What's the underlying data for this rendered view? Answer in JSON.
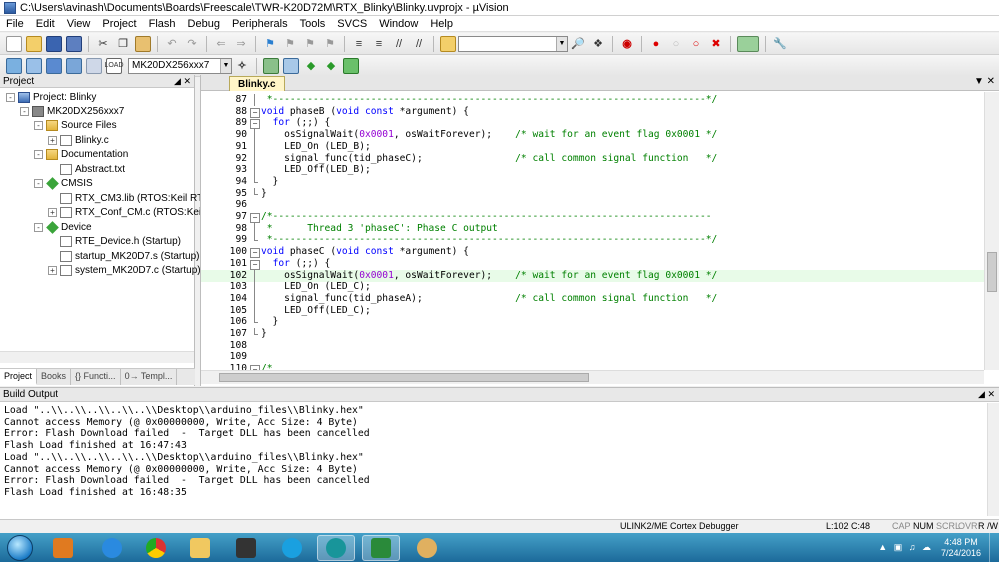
{
  "window": {
    "title": "C:\\Users\\avinash\\Documents\\Boards\\Freescale\\TWR-K20D72M\\RTX_Blinky\\Blinky.uvprojx - µVision"
  },
  "menu": [
    "File",
    "Edit",
    "View",
    "Project",
    "Flash",
    "Debug",
    "Peripherals",
    "Tools",
    "SVCS",
    "Window",
    "Help"
  ],
  "toolbar": {
    "find_value": "",
    "target_select": "MK20DX256xxx7"
  },
  "project_panel": {
    "title": "Project",
    "tree": [
      {
        "label": "Project: Blinky",
        "icon": "project-icon",
        "expander": "-"
      },
      {
        "label": "MK20DX256xxx7",
        "icon": "target-icon",
        "expander": "-"
      },
      {
        "label": "Source Files",
        "icon": "folder-icon",
        "expander": "-"
      },
      {
        "label": "Blinky.c",
        "icon": "file-icon",
        "expander": "+"
      },
      {
        "label": "Documentation",
        "icon": "folder-icon",
        "expander": "-"
      },
      {
        "label": "Abstract.txt",
        "icon": "file-icon",
        "expander": ""
      },
      {
        "label": "CMSIS",
        "icon": "component-icon",
        "expander": "-"
      },
      {
        "label": "RTX_CM3.lib (RTOS:Keil RTX)",
        "icon": "file-icon",
        "expander": ""
      },
      {
        "label": "RTX_Conf_CM.c (RTOS:Keil RT",
        "icon": "file-icon",
        "expander": "+"
      },
      {
        "label": "Device",
        "icon": "component-icon",
        "expander": "-"
      },
      {
        "label": "RTE_Device.h (Startup)",
        "icon": "file-icon",
        "expander": ""
      },
      {
        "label": "startup_MK20D7.s (Startup)",
        "icon": "file-icon",
        "expander": ""
      },
      {
        "label": "system_MK20D7.c (Startup)",
        "icon": "file-icon",
        "expander": "+"
      }
    ],
    "tabs": [
      "Project",
      "Books",
      "{} Functi...",
      "0→ Templ..."
    ]
  },
  "editor": {
    "tab": "Blinky.c",
    "lines": [
      {
        "n": "87",
        "fold": "bar",
        "t": " *---------------------------------------------------------------------------*/",
        "hl": false
      },
      {
        "n": "88",
        "fold": "box",
        "t": "void phaseB (void const *argument) {",
        "hl": false
      },
      {
        "n": "89",
        "fold": "box",
        "t": "  for (;;) {",
        "hl": false
      },
      {
        "n": "90",
        "fold": "bar",
        "t": "    osSignalWait(0x0001, osWaitForever);    /* wait for an event flag 0x0001 */",
        "hl": false
      },
      {
        "n": "91",
        "fold": "bar",
        "t": "    LED_On (LED_B);",
        "hl": false
      },
      {
        "n": "92",
        "fold": "bar",
        "t": "    signal_func(tid_phaseC);                /* call common signal function   */",
        "hl": false
      },
      {
        "n": "93",
        "fold": "bar",
        "t": "    LED_Off(LED_B);",
        "hl": false
      },
      {
        "n": "94",
        "fold": "end",
        "t": "  }",
        "hl": false
      },
      {
        "n": "95",
        "fold": "end",
        "t": "}",
        "hl": false
      },
      {
        "n": "96",
        "fold": "",
        "t": "",
        "hl": false
      },
      {
        "n": "97",
        "fold": "box",
        "t": "/*----------------------------------------------------------------------------",
        "hl": false
      },
      {
        "n": "98",
        "fold": "bar",
        "t": " *      Thread 3 'phaseC': Phase C output",
        "hl": false
      },
      {
        "n": "99",
        "fold": "end",
        "t": " *---------------------------------------------------------------------------*/",
        "hl": false
      },
      {
        "n": "100",
        "fold": "box",
        "t": "void phaseC (void const *argument) {",
        "hl": false
      },
      {
        "n": "101",
        "fold": "box",
        "t": "  for (;;) {",
        "hl": false
      },
      {
        "n": "102",
        "fold": "bar",
        "t": "    osSignalWait(0x0001, osWaitForever);    /* wait for an event flag 0x0001 */",
        "hl": true
      },
      {
        "n": "103",
        "fold": "bar",
        "t": "    LED_On (LED_C);",
        "hl": false
      },
      {
        "n": "104",
        "fold": "bar",
        "t": "    signal_func(tid_phaseA);                /* call common signal function   */",
        "hl": false
      },
      {
        "n": "105",
        "fold": "bar",
        "t": "    LED_Off(LED_C);",
        "hl": false
      },
      {
        "n": "106",
        "fold": "end",
        "t": "  }",
        "hl": false
      },
      {
        "n": "107",
        "fold": "end",
        "t": "}",
        "hl": false
      },
      {
        "n": "108",
        "fold": "",
        "t": "",
        "hl": false
      },
      {
        "n": "109",
        "fold": "",
        "t": "",
        "hl": false
      },
      {
        "n": "110",
        "fold": "box",
        "t": "/*",
        "hl": false
      }
    ]
  },
  "build_output": {
    "title": "Build Output",
    "lines": [
      "Load \"..\\\\..\\\\..\\\\..\\\\..\\\\Desktop\\\\arduino_files\\\\Blinky.hex\"",
      "Cannot access Memory (@ 0x00000000, Write, Acc Size: 4 Byte)",
      "Error: Flash Download failed  -  Target DLL has been cancelled",
      "Flash Load finished at 16:47:43",
      "Load \"..\\\\..\\\\..\\\\..\\\\..\\\\Desktop\\\\arduino_files\\\\Blinky.hex\"",
      "Cannot access Memory (@ 0x00000000, Write, Acc Size: 4 Byte)",
      "Error: Flash Download failed  -  Target DLL has been cancelled",
      "Flash Load finished at 16:48:35"
    ]
  },
  "status": {
    "debugger": "ULINK2/ME Cortex Debugger",
    "position": "L:102 C:48",
    "cap": "CAP",
    "num": "NUM",
    "scrl": "SCRL",
    "ovr": "OVR",
    "rw": "R /W"
  },
  "taskbar": {
    "apps": [
      "media-player-icon",
      "internet-explorer-icon",
      "chrome-icon",
      "explorer-icon",
      "app-icon",
      "skype-icon",
      "arduino-icon",
      "uvision-icon",
      "paint-icon"
    ],
    "time": "4:48 PM",
    "date": "7/24/2016"
  }
}
